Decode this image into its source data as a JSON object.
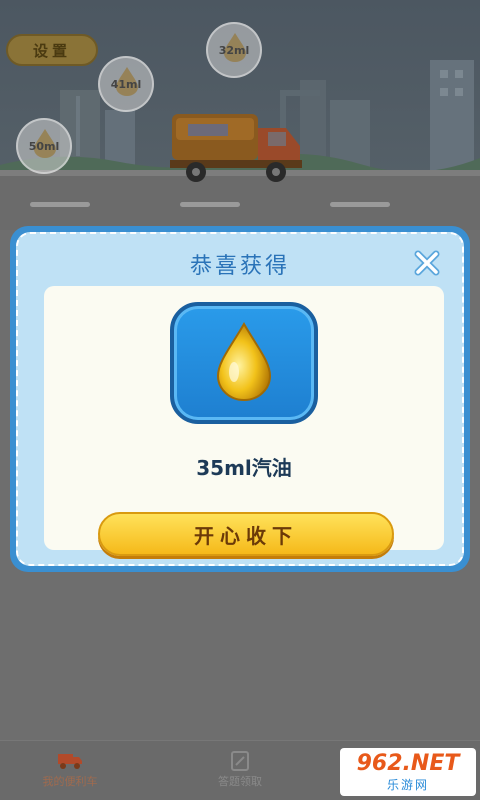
{
  "hud": {
    "settings_label": "设置",
    "fuel_bubbles": [
      {
        "label": "32ml"
      },
      {
        "label": "41ml"
      },
      {
        "label": "50ml"
      }
    ]
  },
  "modal": {
    "title": "恭喜获得",
    "reward_icon": "oil-drop-icon",
    "reward_text": "35ml汽油",
    "accept_button": "开心收下"
  },
  "bottom_nav": {
    "items": [
      {
        "label": "我的便利车",
        "icon": "truck-icon",
        "active": true
      },
      {
        "label": "答题领取",
        "icon": "edit-icon",
        "active": false
      }
    ]
  },
  "watermark": {
    "number": "962.NET",
    "subtitle": "乐游网"
  },
  "colors": {
    "modal_border": "#3a8fd1",
    "modal_fill": "#bfe1f5",
    "title": "#2a73b8",
    "button_yellow": "#f5c21a",
    "tile_blue": "#1e7fd0"
  }
}
